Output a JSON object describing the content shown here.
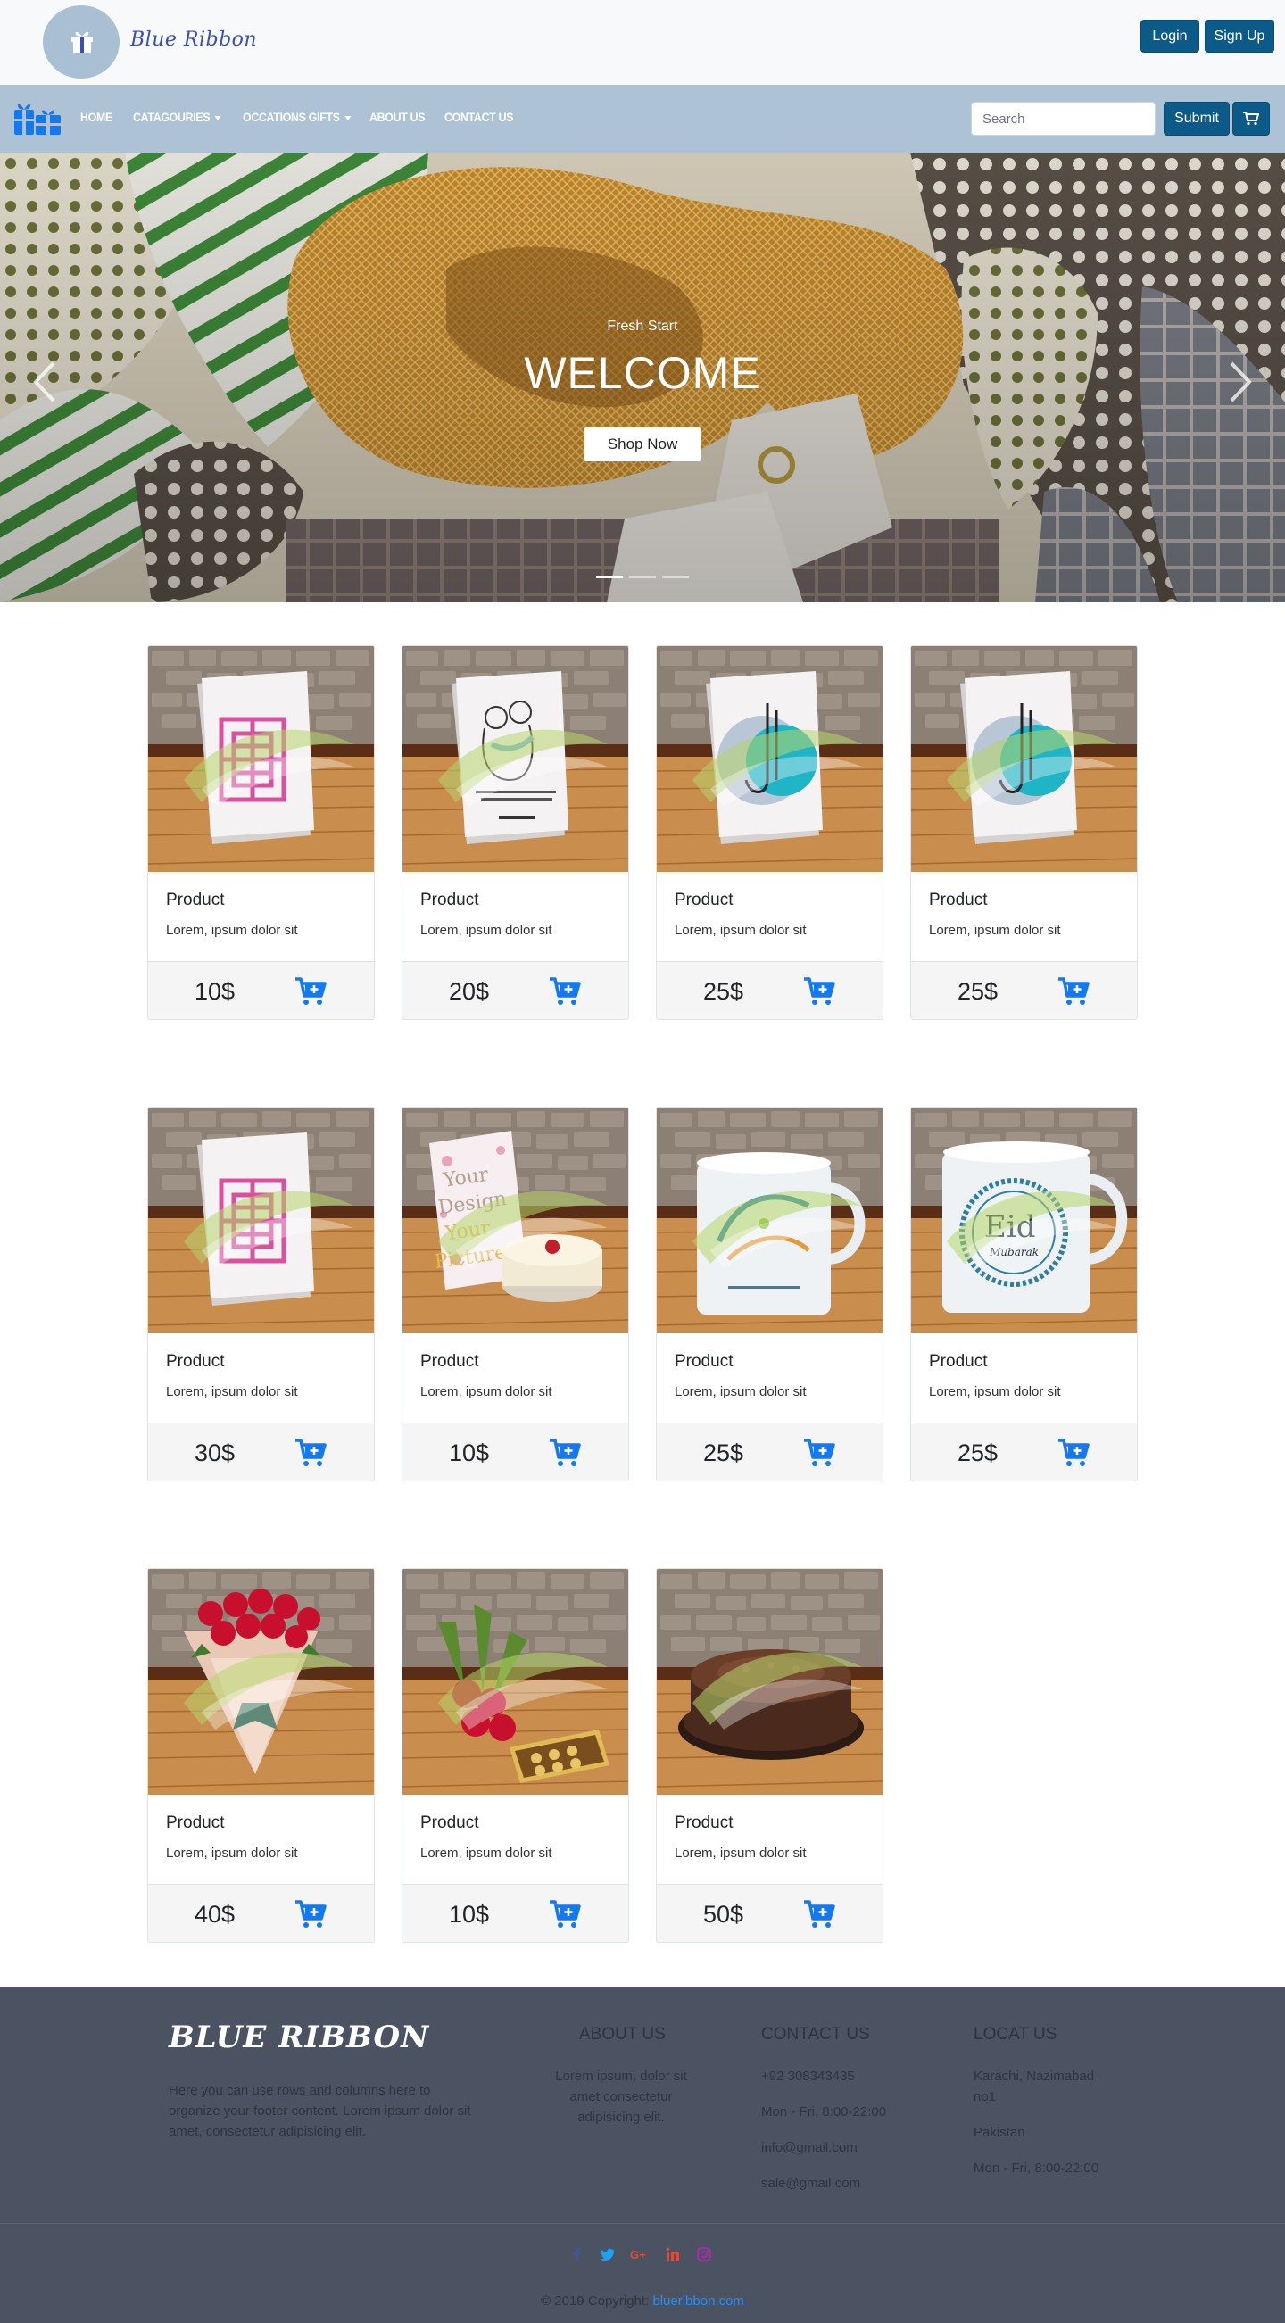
{
  "header": {
    "brand": "Blue Ribbon",
    "login_label": "Login",
    "signup_label": "Sign Up"
  },
  "nav": {
    "items": [
      {
        "label": "HOME"
      },
      {
        "label": "CATAGOURIES"
      },
      {
        "label": "OCCATIONS GIFTS"
      },
      {
        "label": "ABOUT US"
      },
      {
        "label": "CONTACT US"
      }
    ],
    "search_placeholder": "Search",
    "submit_label": "Submit"
  },
  "hero": {
    "subtitle": "Fresh Start",
    "title": "WELCOME",
    "button_label": "Shop Now",
    "active_slide": 1,
    "slide_count": 3
  },
  "products": [
    {
      "title": "Product",
      "text": "Lorem, ipsum dolor sit",
      "price": "10$",
      "image": "eid-calligraphy-pink-card"
    },
    {
      "title": "Product",
      "text": "Lorem, ipsum dolor sit",
      "price": "20$",
      "image": "eid-hug-card"
    },
    {
      "title": "Product",
      "text": "Lorem, ipsum dolor sit",
      "price": "25$",
      "image": "eid-teal-circle-card"
    },
    {
      "title": "Product",
      "text": "Lorem, ipsum dolor sit",
      "price": "25$",
      "image": "eid-teal-circle-card"
    },
    {
      "title": "Product",
      "text": "Lorem, ipsum dolor sit",
      "price": "30$",
      "image": "eid-calligraphy-pink-card"
    },
    {
      "title": "Product",
      "text": "Lorem, ipsum dolor sit",
      "price": "10$",
      "image": "your-design-card-cake"
    },
    {
      "title": "Product",
      "text": "Lorem, ipsum dolor sit",
      "price": "25$",
      "image": "eid-mug-calligraphy"
    },
    {
      "title": "Product",
      "text": "Lorem, ipsum dolor sit",
      "price": "25$",
      "image": "eid-mubarak-mug"
    },
    {
      "title": "Product",
      "text": "Lorem, ipsum dolor sit",
      "price": "40$",
      "image": "red-rose-bouquet"
    },
    {
      "title": "Product",
      "text": "Lorem, ipsum dolor sit",
      "price": "10$",
      "image": "roses-chocolates"
    },
    {
      "title": "Product",
      "text": "Lorem, ipsum dolor sit",
      "price": "50$",
      "image": "chocolate-cake"
    }
  ],
  "footer": {
    "brand": "BLUE RIBBON",
    "description": "Here you can use rows and columns here to organize your footer content. Lorem ipsum dolor sit amet, consectetur adipisicing elit.",
    "about_heading": "ABOUT US",
    "about_text": "Lorem ipsum, dolor sit amet consectetur adipisicing elit.",
    "contact_heading": "CONTACT US",
    "contact_lines": [
      "+92 308343435",
      "Mon - Fri, 8:00-22:00",
      "info@gmail.com",
      "sale@gmail.com"
    ],
    "locate_heading": "LOCAT US",
    "locate_lines": [
      "Karachi, Nazimabad no1",
      "Pakistan",
      "Mon - Fri, 8:00-22:00"
    ],
    "social": [
      "facebook-icon",
      "twitter-icon",
      "google-plus-icon",
      "linkedin-icon",
      "instagram-icon"
    ],
    "copyright_text": "© 2019 Copyright:",
    "copyright_link": "blueribbon.com"
  },
  "colors": {
    "topbar_bg": "#f8f9fa",
    "navbar_bg": "#adc3d5",
    "button_bg": "#0c5a87",
    "cart_icon": "#1478f0",
    "footer_bg": "#4b5363"
  }
}
